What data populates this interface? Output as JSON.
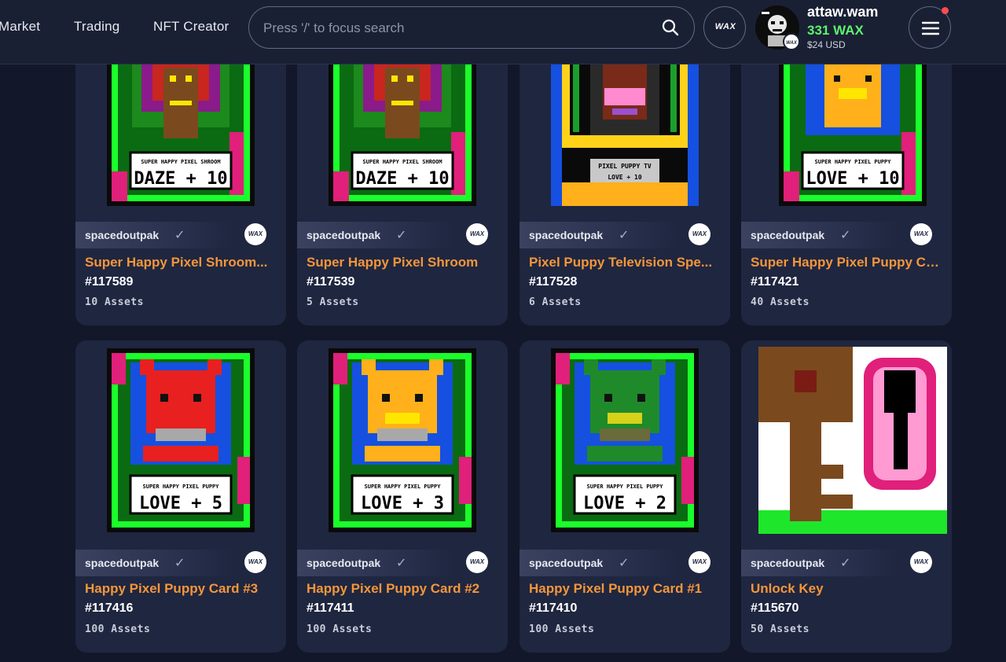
{
  "nav": {
    "links": [
      "Market",
      "Trading",
      "NFT Creator"
    ]
  },
  "search": {
    "placeholder": "Press '/' to focus search"
  },
  "wax_button": {
    "label": "WAX"
  },
  "account": {
    "username": "attaw.wam",
    "balance": "331 WAX",
    "usd": "$24 USD",
    "avatar_badge": "WAX"
  },
  "colors": {
    "accent_title": "#f4963a",
    "balance_green": "#5ef26f",
    "background": "#13172a",
    "card": "#1f2640"
  },
  "icons": {
    "search": "search-icon",
    "menu": "hamburger-menu-icon",
    "verified": "checkmark-icon"
  },
  "cards": [
    {
      "creator": "spacedoutpak",
      "badge": "WAX",
      "title": "Super Happy Pixel Shroom...",
      "id": "#117589",
      "assets": "10 Assets",
      "art_caption_top": "SUPER HAPPY PIXEL SHROOM",
      "art_caption_main": "DAZE + 10"
    },
    {
      "creator": "spacedoutpak",
      "badge": "WAX",
      "title": "Super Happy Pixel Shroom",
      "id": "#117539",
      "assets": "5 Assets",
      "art_caption_top": "SUPER HAPPY PIXEL SHROOM",
      "art_caption_main": "DAZE + 10"
    },
    {
      "creator": "spacedoutpak",
      "badge": "WAX",
      "title": "Pixel Puppy Television Spe...",
      "id": "#117528",
      "assets": "6 Assets",
      "art_caption_top": "PIXEL PUPPY TV",
      "art_caption_main": "LOVE + 10"
    },
    {
      "creator": "spacedoutpak",
      "badge": "WAX",
      "title": "Super Happy Pixel Puppy Ca...",
      "id": "#117421",
      "assets": "40 Assets",
      "art_caption_top": "SUPER HAPPY PIXEL PUPPY",
      "art_caption_main": "LOVE + 10"
    },
    {
      "creator": "spacedoutpak",
      "badge": "WAX",
      "title": "Happy Pixel Puppy Card #3",
      "id": "#117416",
      "assets": "100 Assets",
      "art_caption_top": "SUPER HAPPY PIXEL PUPPY",
      "art_caption_main": "LOVE + 5"
    },
    {
      "creator": "spacedoutpak",
      "badge": "WAX",
      "title": "Happy Pixel Puppy Card #2",
      "id": "#117411",
      "assets": "100 Assets",
      "art_caption_top": "SUPER HAPPY PIXEL PUPPY",
      "art_caption_main": "LOVE + 3"
    },
    {
      "creator": "spacedoutpak",
      "badge": "WAX",
      "title": "Happy Pixel Puppy Card #1",
      "id": "#117410",
      "assets": "100 Assets",
      "art_caption_top": "SUPER HAPPY PIXEL PUPPY",
      "art_caption_main": "LOVE + 2"
    },
    {
      "creator": "spacedoutpak",
      "badge": "WAX",
      "title": "Unlock Key",
      "id": "#115670",
      "assets": "50 Assets"
    }
  ]
}
